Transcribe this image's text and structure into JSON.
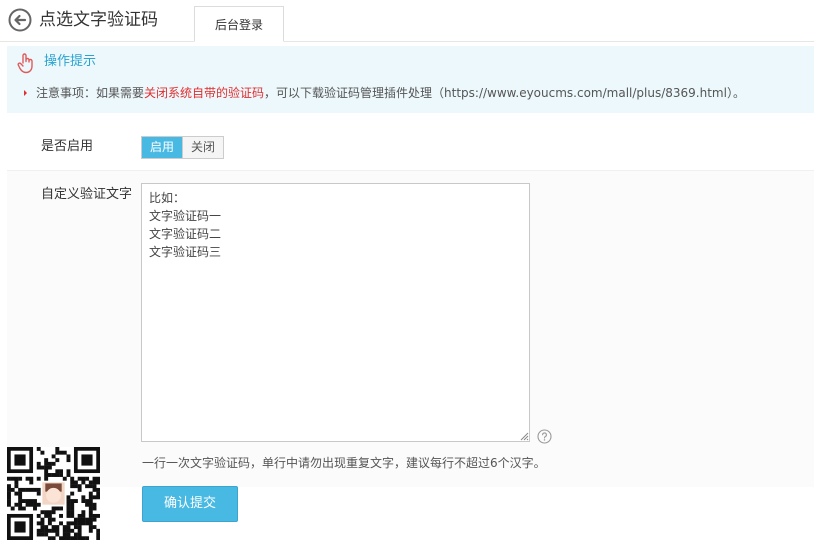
{
  "header": {
    "title": "点选文字验证码",
    "tab_label": "后台登录"
  },
  "tips": {
    "title": "操作提示",
    "note_prefix": "注意事项：如果需要",
    "note_highlight": "关闭系统自带的验证码",
    "note_suffix": "，可以下载验证码管理插件处理（https://www.eyoucms.com/mall/plus/8369.html）。"
  },
  "form": {
    "enable_label": "是否启用",
    "enable_on": "启用",
    "enable_off": "关闭",
    "enabled": true,
    "custom_label": "自定义验证文字",
    "textarea_value": "比如：\n文字验证码一\n文字验证码二\n文字验证码三",
    "hint": "一行一次文字验证码，单行中请勿出现重复文字，建议每行不超过6个汉字。",
    "submit_label": "确认提交"
  },
  "colors": {
    "accent": "#48b9e2",
    "tips_bg": "#edf8fc",
    "tips_title": "#2aa3d0",
    "warning": "#e02f2f"
  },
  "icons": {
    "back": "circle-arrow-left-icon",
    "tips": "hand-pointer-icon",
    "help": "question-circle-icon",
    "qr": "qr-code-icon"
  }
}
